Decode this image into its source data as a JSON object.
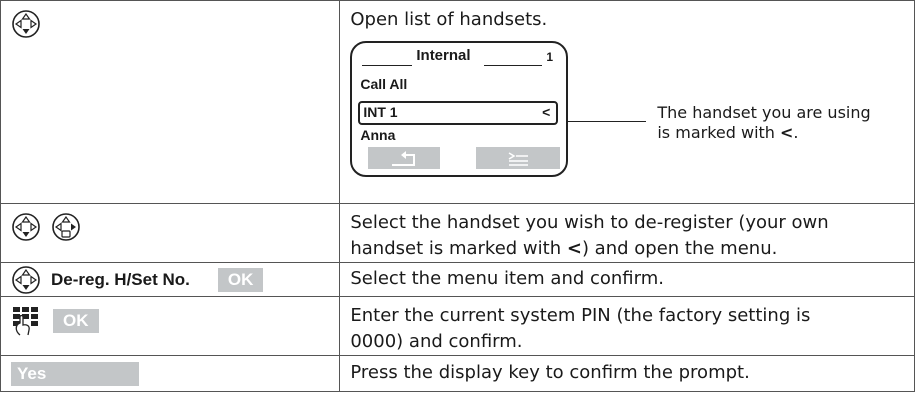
{
  "rows": [
    {
      "left": {
        "icon": "control-key-icon"
      },
      "right": {
        "text": "Open list of handsets."
      }
    },
    {
      "left": {
        "icons": [
          "control-key-down-icon",
          "control-key-menu-icon"
        ]
      },
      "right": {
        "text_a": "Select the handset you wish to de-register (your own",
        "text_b": "handset is marked with ",
        "marker": "<",
        "text_c": ") and open the menu."
      }
    },
    {
      "left": {
        "menu_item": "De-reg. H/Set No.",
        "key": "OK"
      },
      "right": {
        "text": "Select the menu item and confirm."
      }
    },
    {
      "left": {
        "icon": "keypad-icon",
        "key": "OK"
      },
      "right": {
        "text_a": "Enter the current system PIN (the factory setting is",
        "text_b": "0000) and confirm."
      }
    },
    {
      "left": {
        "key": "Yes"
      },
      "right": {
        "text": "Press the display key to confirm the prompt."
      }
    }
  ],
  "display": {
    "title": "Internal",
    "title_number": "1",
    "items": [
      "Call All",
      "INT 1",
      "Anna"
    ],
    "selected_marker": "<",
    "softkeys": [
      "back-arrow-icon",
      "menu-icon"
    ]
  },
  "callout": {
    "line1": "The handset you are using",
    "line2_prefix": "is marked with ",
    "marker": "<",
    "line2_suffix": "."
  }
}
